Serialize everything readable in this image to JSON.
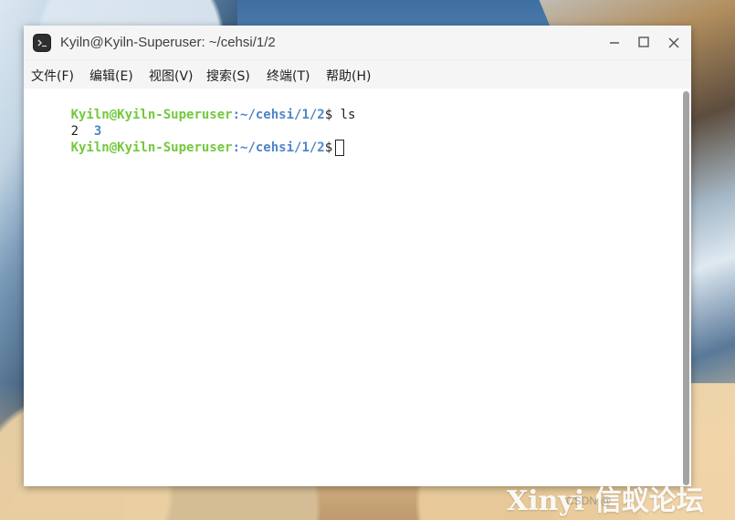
{
  "window": {
    "title": "Kyiln@Kyiln-Superuser: ~/cehsi/1/2"
  },
  "menu": {
    "file": "文件(F)",
    "edit": "编辑(E)",
    "view": "视图(V)",
    "search": "搜索(S)",
    "terminal": "终端(T)",
    "help": "帮助(H)"
  },
  "terminal": {
    "line1": {
      "user": "Kyiln@Kyiln-Superuser",
      "path": ":~/cehsi/1/2",
      "suffix": "$ ls"
    },
    "line2": {
      "file": "2",
      "dir": "3"
    },
    "line3": {
      "user": "Kyiln@Kyiln-Superuser",
      "path": ":~/cehsi/1/2",
      "suffix": "$"
    }
  },
  "watermark": {
    "main": "Xinyi 信蚁论坛",
    "sub": "CSDN @"
  },
  "icons": {
    "app": "terminal-icon",
    "minimize": "minimize-icon",
    "maximize": "maximize-icon",
    "close": "close-icon"
  },
  "colors": {
    "user": "#74c83d",
    "path": "#4f86c6",
    "text": "#222222",
    "title": "#404040"
  }
}
